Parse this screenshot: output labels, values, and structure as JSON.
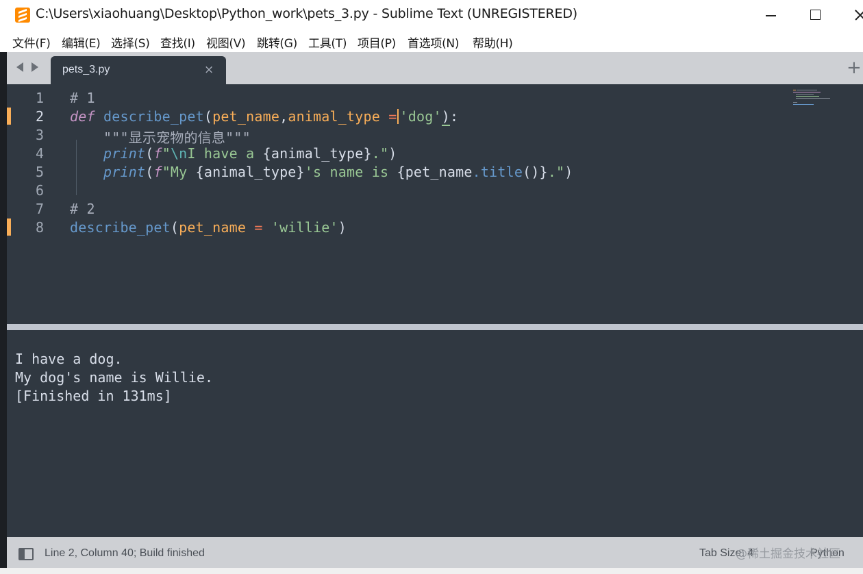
{
  "window": {
    "title": "C:\\Users\\xiaohuang\\Desktop\\Python_work\\pets_3.py - Sublime Text (UNREGISTERED)"
  },
  "menu": [
    {
      "label": "文件(F)"
    },
    {
      "label": "编辑(E)"
    },
    {
      "label": "选择(S)"
    },
    {
      "label": "查找(I)"
    },
    {
      "label": "视图(V)"
    },
    {
      "label": "跳转(G)"
    },
    {
      "label": "工具(T)"
    },
    {
      "label": "项目(P)"
    },
    {
      "label": "首选项(N)"
    },
    {
      "label": "帮助(H)"
    }
  ],
  "tabs": [
    {
      "label": "pets_3.py",
      "close_glyph": "×",
      "active": true
    }
  ],
  "new_tab_glyph": "+",
  "editor": {
    "active_line": 2,
    "modified_lines": [
      2,
      8
    ],
    "lines": [
      {
        "number": "1",
        "text": "# 1"
      },
      {
        "number": "2",
        "text": "def describe_pet(pet_name,animal_type ='dog'):"
      },
      {
        "number": "3",
        "text": "    \"\"\"显示宠物的信息\"\"\""
      },
      {
        "number": "4",
        "text": "    print(f\"\\nI have a {animal_type}.\")"
      },
      {
        "number": "5",
        "text": "    print(f\"My {animal_type}'s name is {pet_name.title()}.\")"
      },
      {
        "number": "6",
        "text": ""
      },
      {
        "number": "7",
        "text": "# 2"
      },
      {
        "number": "8",
        "text": "describe_pet(pet_name = 'willie')"
      }
    ]
  },
  "output": {
    "lines": [
      "I have a dog.",
      "My dog's name is Willie.",
      "[Finished in 131ms]"
    ]
  },
  "status": {
    "text": "Line 2, Column 40; Build finished",
    "tab_size": "Tab Size: 4",
    "syntax": "Python",
    "watermark": "@稀土掘金技术社区"
  },
  "colors": {
    "editor_bg": "#303841",
    "chrome_bg": "#ced0d4",
    "accent": "#f9ae58",
    "keyword": "#c695c6",
    "function": "#6699cc",
    "string": "#99c794",
    "operator": "#f97b58"
  },
  "icons": {
    "app": "sublime-text-logo-icon",
    "nav": "tab-nav-arrows-icon",
    "panel": "toggle-side-panel-icon"
  }
}
